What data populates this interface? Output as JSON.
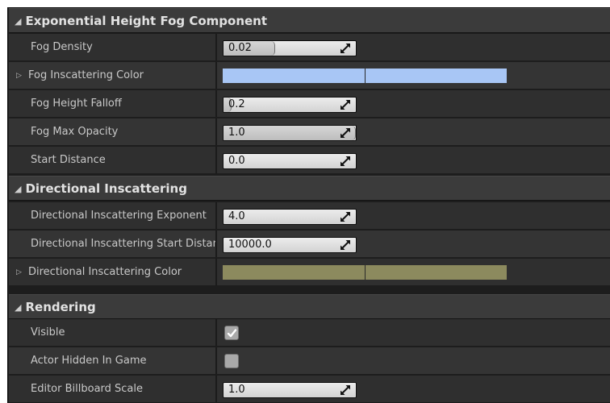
{
  "sections": [
    {
      "title": "Exponential Height Fog Component",
      "rows": [
        {
          "label": "Fog Density",
          "value": "0.02",
          "slider_fraction": 0.39
        },
        {
          "label": "Fog Inscattering Color",
          "color": "#a8c6f5"
        },
        {
          "label": "Fog Height Falloff",
          "value": "0.2",
          "slider_fraction": 0.06
        },
        {
          "label": "Fog Max Opacity",
          "value": "1.0",
          "slider_fraction": 1.0
        },
        {
          "label": "Start Distance",
          "value": "0.0"
        }
      ]
    },
    {
      "title": "Directional Inscattering",
      "rows": [
        {
          "label": "Directional Inscattering Exponent",
          "value": "4.0"
        },
        {
          "label": "Directional Inscattering Start Distance",
          "value": "10000.0"
        },
        {
          "label": "Directional Inscattering Color",
          "color": "#8c8a5e"
        }
      ]
    },
    {
      "title": "Rendering",
      "rows": [
        {
          "label": "Visible",
          "checked": true
        },
        {
          "label": "Actor Hidden In Game",
          "checked": false
        },
        {
          "label": "Editor Billboard Scale",
          "value": "1.0"
        }
      ]
    }
  ],
  "icons": {
    "collapse": "triangle-down-icon",
    "expand": "triangle-right-icon",
    "resize": "resize-arrows-icon",
    "check": "checkmark-icon"
  },
  "colors": {
    "header_bg": "#3b3b3b",
    "row_bg": "#2f2f2f",
    "label_text": "#c9c9c9",
    "numbox_bg": "#dcdcdc"
  }
}
